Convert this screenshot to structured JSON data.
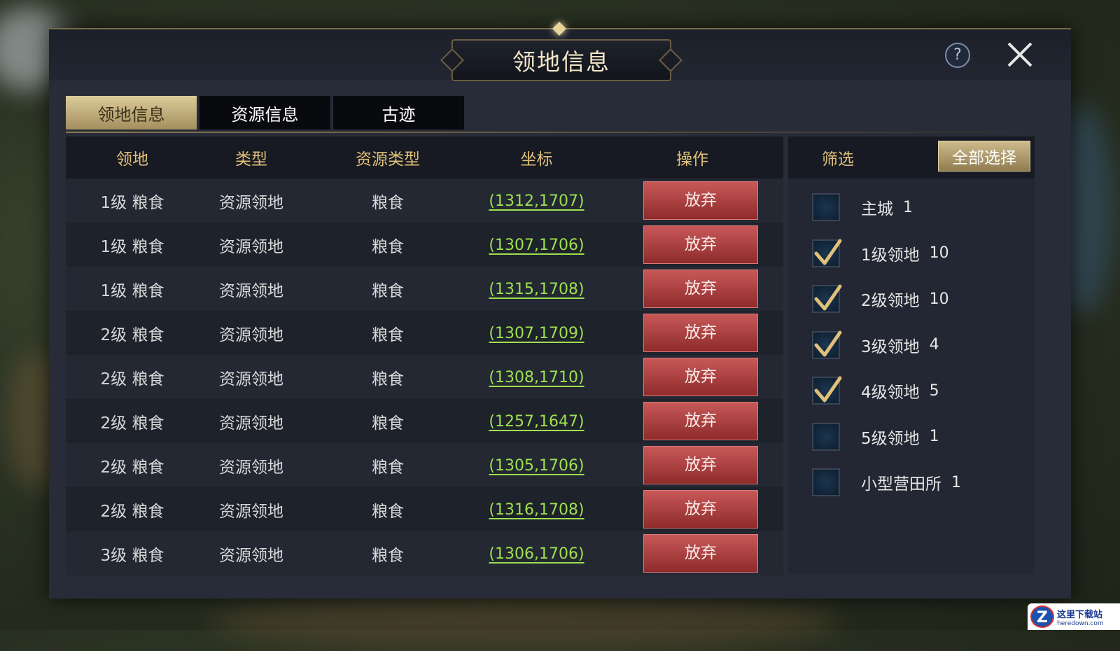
{
  "window": {
    "title": "领地信息"
  },
  "tabs": [
    {
      "label": "领地信息",
      "active": true
    },
    {
      "label": "资源信息",
      "active": false
    },
    {
      "label": "古迹",
      "active": false
    }
  ],
  "table": {
    "headers": [
      "领地",
      "类型",
      "资源类型",
      "坐标",
      "操作"
    ],
    "rows": [
      {
        "level": "1级",
        "name": "粮食",
        "type": "资源领地",
        "resource": "粮食",
        "coord": "(1312,1707)",
        "action": "放弃"
      },
      {
        "level": "1级",
        "name": "粮食",
        "type": "资源领地",
        "resource": "粮食",
        "coord": "(1307,1706)",
        "action": "放弃"
      },
      {
        "level": "1级",
        "name": "粮食",
        "type": "资源领地",
        "resource": "粮食",
        "coord": "(1315,1708)",
        "action": "放弃"
      },
      {
        "level": "2级",
        "name": "粮食",
        "type": "资源领地",
        "resource": "粮食",
        "coord": "(1307,1709)",
        "action": "放弃"
      },
      {
        "level": "2级",
        "name": "粮食",
        "type": "资源领地",
        "resource": "粮食",
        "coord": "(1308,1710)",
        "action": "放弃"
      },
      {
        "level": "2级",
        "name": "粮食",
        "type": "资源领地",
        "resource": "粮食",
        "coord": "(1257,1647)",
        "action": "放弃"
      },
      {
        "level": "2级",
        "name": "粮食",
        "type": "资源领地",
        "resource": "粮食",
        "coord": "(1305,1706)",
        "action": "放弃"
      },
      {
        "level": "2级",
        "name": "粮食",
        "type": "资源领地",
        "resource": "粮食",
        "coord": "(1316,1708)",
        "action": "放弃"
      },
      {
        "level": "3级",
        "name": "粮食",
        "type": "资源领地",
        "resource": "粮食",
        "coord": "(1306,1706)",
        "action": "放弃"
      }
    ]
  },
  "filter": {
    "title": "筛选",
    "select_all_label": "全部选择",
    "items": [
      {
        "label": "主城",
        "count": "1",
        "checked": false
      },
      {
        "label": "1级领地",
        "count": "10",
        "checked": true
      },
      {
        "label": "2级领地",
        "count": "10",
        "checked": true
      },
      {
        "label": "3级领地",
        "count": "4",
        "checked": true
      },
      {
        "label": "4级领地",
        "count": "5",
        "checked": true
      },
      {
        "label": "5级领地",
        "count": "1",
        "checked": false
      },
      {
        "label": "小型营田所",
        "count": "1",
        "checked": false
      }
    ]
  },
  "icons": {
    "help": "?",
    "close": "close-icon",
    "check": "check-icon"
  },
  "colors": {
    "accent_gold": "#e0c07a",
    "coord_green": "#9fe050",
    "abandon_red": "#b04040",
    "check_gold": "#e0c07a"
  },
  "watermark": {
    "logo": "Z",
    "text_cn": "这里下载站",
    "text_en": "heredown.com"
  }
}
